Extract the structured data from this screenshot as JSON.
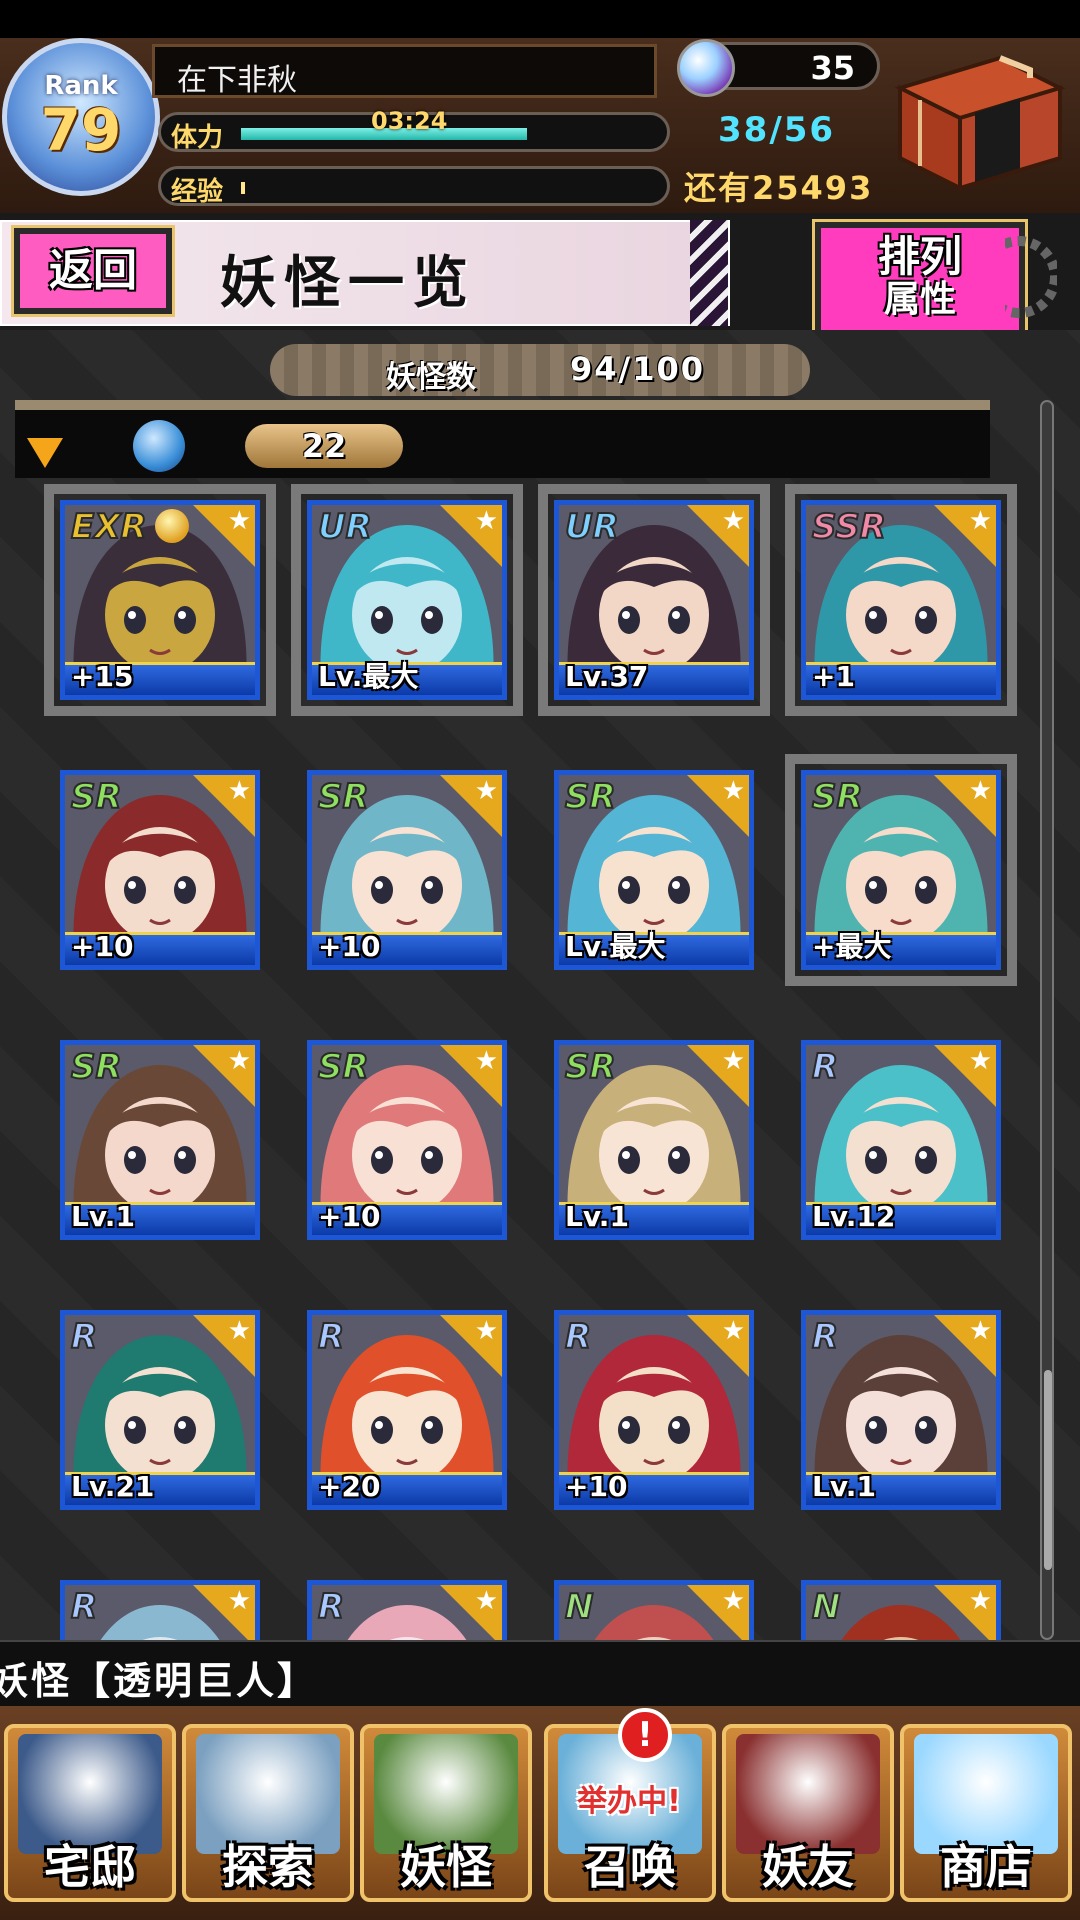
{
  "hud": {
    "rank_label": "Rank",
    "rank_value": "79",
    "player_name": "在下非秋",
    "stamina_label": "体力",
    "stamina_timer": "03:24",
    "stamina_value": "38/56",
    "stamina_fraction": 0.68,
    "exp_label": "经验",
    "exp_remaining": "还有25493",
    "exp_fraction": 0.01,
    "gem_count": "35",
    "gem_icon": "spirit-orb-icon",
    "chest_icon": "storage-chest-icon"
  },
  "header": {
    "back_label": "返回",
    "page_title": "妖怪一览",
    "sort_label": "排列",
    "sort_sub": "属性"
  },
  "list": {
    "count_label": "妖怪数",
    "count_value": "94/100",
    "filter_count": "22",
    "filter_element_icon": "water-element-icon",
    "cards": [
      {
        "rarity": "EXR",
        "level": "+15",
        "crown": true,
        "selected": true,
        "color": "#3a2e3a",
        "accent": "#c9a640"
      },
      {
        "rarity": "UR",
        "level": "Lv.最大",
        "selected": true,
        "color": "#3fb7c9",
        "accent": "#bfe8f0"
      },
      {
        "rarity": "UR",
        "level": "Lv.37",
        "selected": true,
        "color": "#3a2a3a",
        "accent": "#f2d6c6"
      },
      {
        "rarity": "SSR",
        "level": "+1",
        "selected": true,
        "color": "#2f98a8",
        "accent": "#f4d8c8"
      },
      {
        "rarity": "SR",
        "level": "+10",
        "color": "#8a2a2a",
        "accent": "#f4dccc"
      },
      {
        "rarity": "SR",
        "level": "+10",
        "color": "#6fb6c8",
        "accent": "#f7e2d4"
      },
      {
        "rarity": "SR",
        "level": "Lv.最大",
        "color": "#54b5d4",
        "accent": "#f7e2d0"
      },
      {
        "rarity": "SR",
        "level": "+最大",
        "selected": true,
        "color": "#4fb4b0",
        "accent": "#f7dccc"
      },
      {
        "rarity": "SR",
        "level": "Lv.1",
        "color": "#6a4838",
        "accent": "#f4d8cc"
      },
      {
        "rarity": "SR",
        "level": "+10",
        "color": "#e07a7a",
        "accent": "#f8e0d4"
      },
      {
        "rarity": "SR",
        "level": "Lv.1",
        "color": "#c8b07a",
        "accent": "#f8e4d4"
      },
      {
        "rarity": "R",
        "level": "Lv.12",
        "color": "#4cc0c8",
        "accent": "#f4e0d0"
      },
      {
        "rarity": "R",
        "level": "Lv.21",
        "color": "#1f7a70",
        "accent": "#f4e0d0"
      },
      {
        "rarity": "R",
        "level": "+20",
        "color": "#e0502a",
        "accent": "#f8e4d0"
      },
      {
        "rarity": "R",
        "level": "+10",
        "color": "#b0283a",
        "accent": "#f4e0c8"
      },
      {
        "rarity": "R",
        "level": "Lv.1",
        "color": "#5a4038",
        "accent": "#f4e0d8"
      },
      {
        "rarity": "R",
        "level": "",
        "color": "#8ab8d0",
        "accent": "#dde8f0"
      },
      {
        "rarity": "R",
        "level": "",
        "color": "#e8a8b8",
        "accent": "#f8e4ec"
      },
      {
        "rarity": "N",
        "level": "",
        "color": "#c05050",
        "accent": "#f0d0c0"
      },
      {
        "rarity": "N",
        "level": "",
        "color": "#a03020",
        "accent": "#e8c0a0"
      }
    ],
    "rarity_colors": {
      "EXR": "#e8c030",
      "UR": "#7fd0ff",
      "SSR": "#f08aa8",
      "SR": "#8fe060",
      "R": "#a8c8ff",
      "N": "#9fe080"
    }
  },
  "ticker": {
    "text": "妖怪【透明巨人】"
  },
  "nav": {
    "items": [
      {
        "label": "宅邸",
        "icon": "mansion-icon",
        "color": "#3c5a8a"
      },
      {
        "label": "探索",
        "icon": "magnifier-map-icon",
        "color": "#7ba0c0"
      },
      {
        "label": "妖怪",
        "icon": "scroll-icon",
        "color": "#5a8a40"
      },
      {
        "label": "召唤",
        "icon": "summon-star-icon",
        "color": "#6ab0d8"
      },
      {
        "label": "妖友",
        "icon": "fox-girl-icon",
        "color": "#8a3030"
      },
      {
        "label": "商店",
        "icon": "crystal-orb-icon",
        "color": "#9ad8ff"
      }
    ],
    "summon_badge": "!",
    "summon_event": "举办中!"
  }
}
